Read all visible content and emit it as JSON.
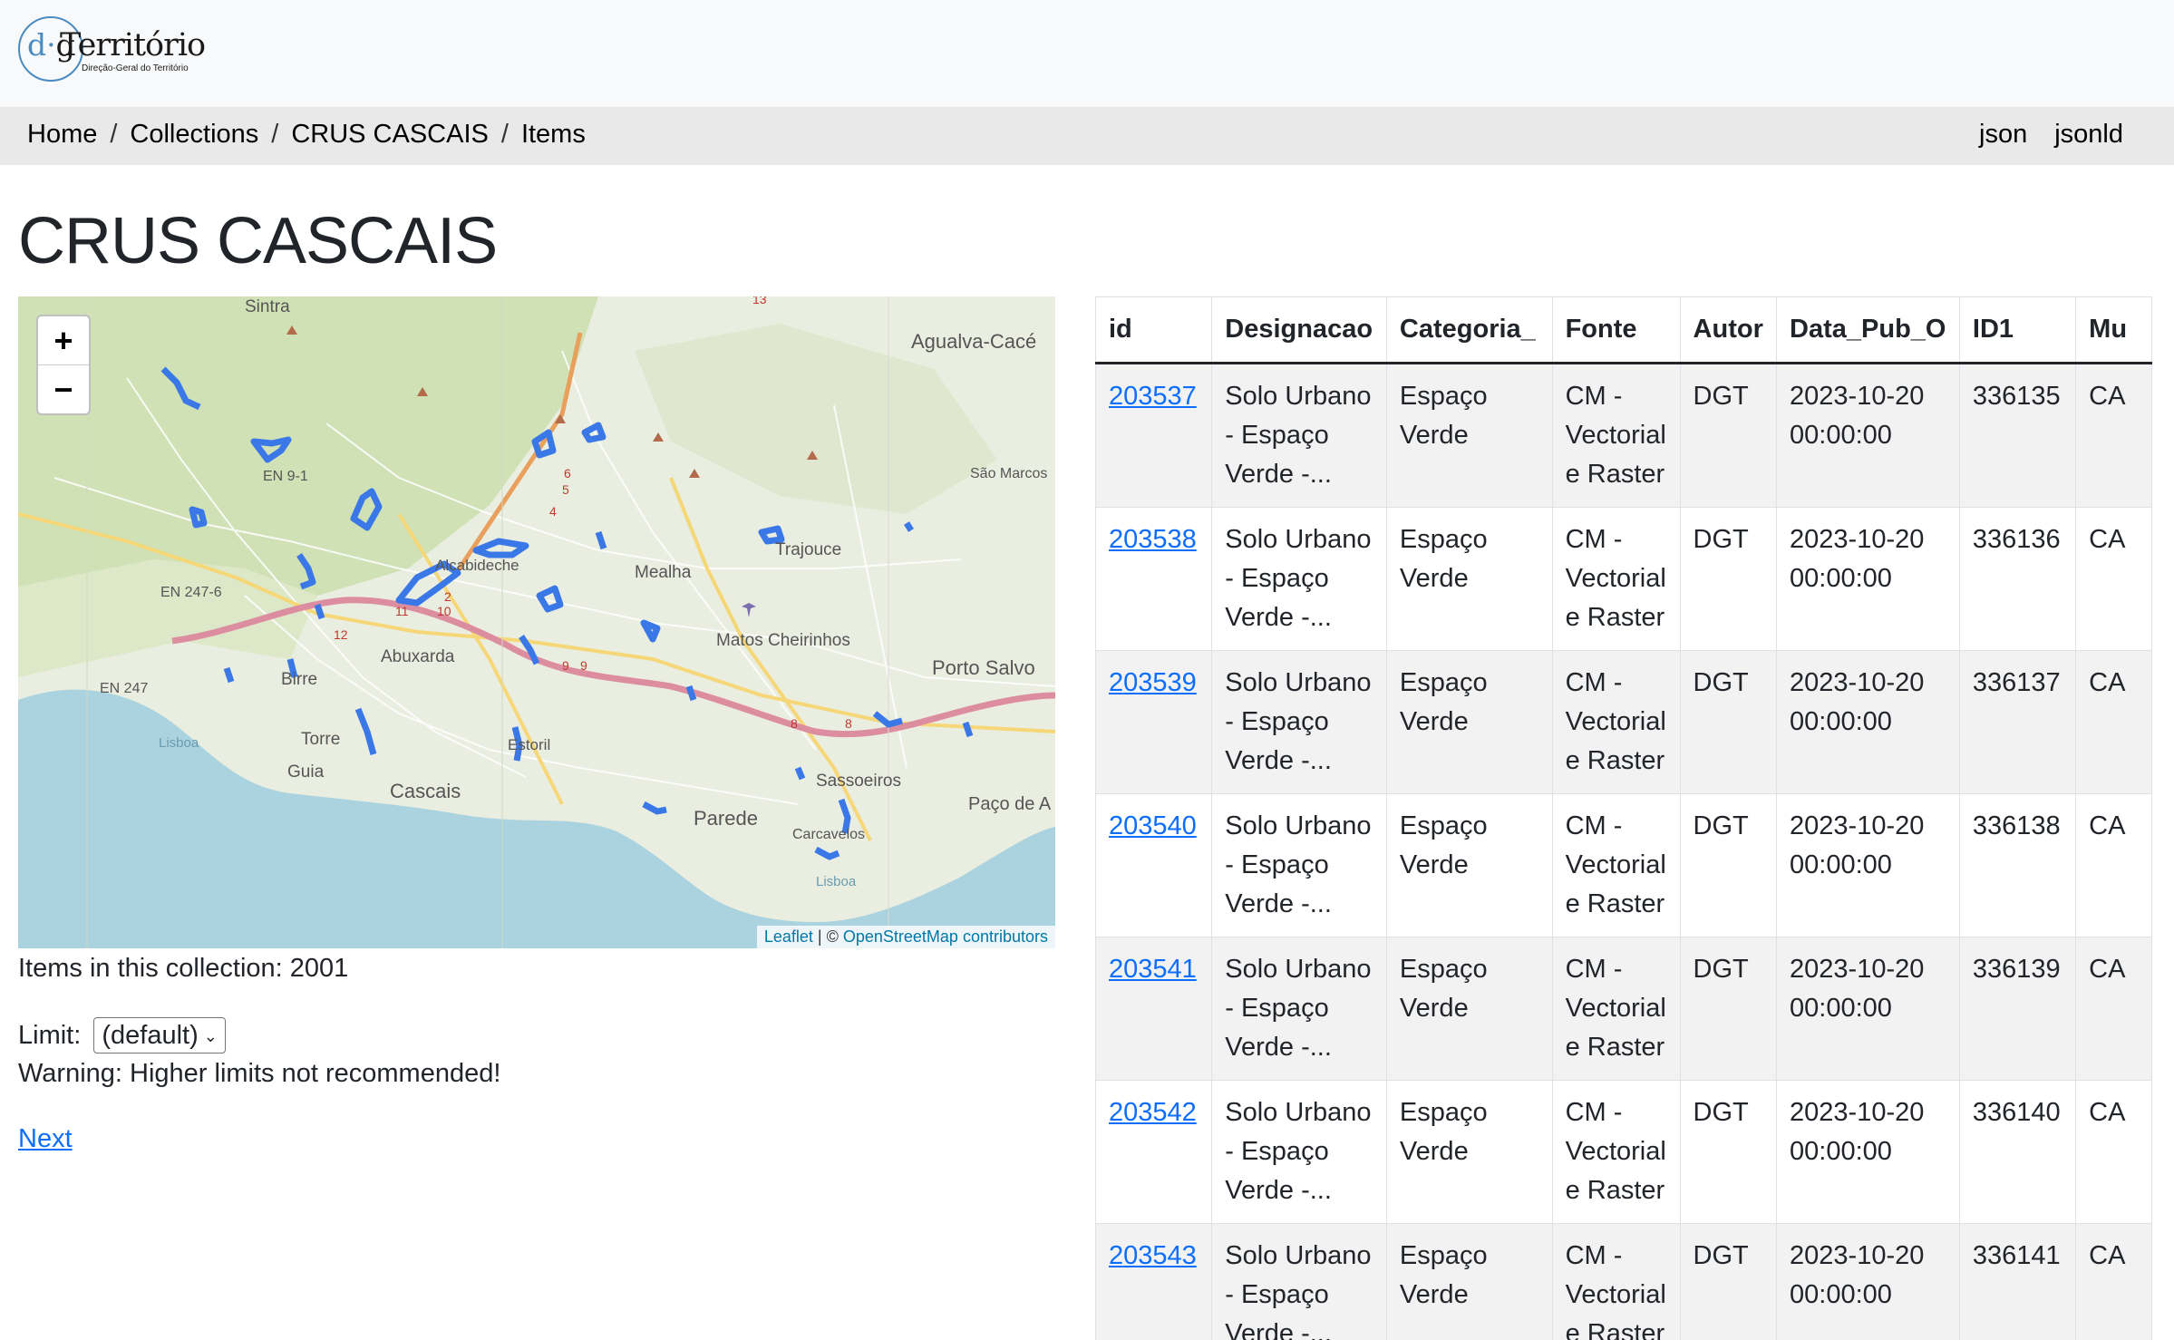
{
  "brand": {
    "logo_prefix_d": "d",
    "logo_prefix_g": "g",
    "logo_name": "Território",
    "logo_sub": "Direção-Geral do Território"
  },
  "breadcrumb": {
    "items": [
      "Home",
      "Collections",
      "CRUS CASCAIS",
      "Items"
    ],
    "separator": "/"
  },
  "formats": [
    "json",
    "jsonld"
  ],
  "page_title": "CRUS CASCAIS",
  "map": {
    "zoom_in": "+",
    "zoom_out": "−",
    "attribution_leaflet": "Leaflet",
    "attribution_sep": " | © ",
    "attribution_osm": "OpenStreetMap contributors",
    "place_labels": [
      "Sintra",
      "Agualva-Cacé",
      "São Marcos",
      "EN 9-1",
      "EN 247-6",
      "EN 247",
      "Alcabideche",
      "Mealha",
      "Trajouce",
      "Matos Cheirinhos",
      "Porto Salvo",
      "Abuxarda",
      "Birre",
      "Torre",
      "Guia",
      "Cascais",
      "Estoril",
      "Parede",
      "Sassoeiros",
      "Carcavelos",
      "Paço de A",
      "Lisboa",
      "Lisboa"
    ],
    "road_numbers": [
      "13",
      "6",
      "5",
      "4",
      "2",
      "11",
      "10",
      "12",
      "9",
      "9",
      "8",
      "8"
    ]
  },
  "items_count_text": "Items in this collection: 2001",
  "limit": {
    "label": "Limit:",
    "selected": "(default)"
  },
  "warning_text": "Warning: Higher limits not recommended!",
  "next_link": "Next",
  "table": {
    "headers": [
      "id",
      "Designacao",
      "Categoria_",
      "Fonte",
      "Autor",
      "Data_Pub_O",
      "ID1",
      "Mu"
    ],
    "rows": [
      {
        "id": "203537",
        "des1": "Solo Urbano",
        "des2": "- Espaço",
        "des3": "Verde -...",
        "cat1": "Espaço",
        "cat2": "Verde",
        "fon1": "CM -",
        "fon2": "Vectorial",
        "fon3": "e Raster",
        "autor": "DGT",
        "dat1": "2023-10-20",
        "dat2": "00:00:00",
        "id1": "336135",
        "mu": "CA"
      },
      {
        "id": "203538",
        "des1": "Solo Urbano",
        "des2": "- Espaço",
        "des3": "Verde -...",
        "cat1": "Espaço",
        "cat2": "Verde",
        "fon1": "CM -",
        "fon2": "Vectorial",
        "fon3": "e Raster",
        "autor": "DGT",
        "dat1": "2023-10-20",
        "dat2": "00:00:00",
        "id1": "336136",
        "mu": "CA"
      },
      {
        "id": "203539",
        "des1": "Solo Urbano",
        "des2": "- Espaço",
        "des3": "Verde -...",
        "cat1": "Espaço",
        "cat2": "Verde",
        "fon1": "CM -",
        "fon2": "Vectorial",
        "fon3": "e Raster",
        "autor": "DGT",
        "dat1": "2023-10-20",
        "dat2": "00:00:00",
        "id1": "336137",
        "mu": "CA"
      },
      {
        "id": "203540",
        "des1": "Solo Urbano",
        "des2": "- Espaço",
        "des3": "Verde -...",
        "cat1": "Espaço",
        "cat2": "Verde",
        "fon1": "CM -",
        "fon2": "Vectorial",
        "fon3": "e Raster",
        "autor": "DGT",
        "dat1": "2023-10-20",
        "dat2": "00:00:00",
        "id1": "336138",
        "mu": "CA"
      },
      {
        "id": "203541",
        "des1": "Solo Urbano",
        "des2": "- Espaço",
        "des3": "Verde -...",
        "cat1": "Espaço",
        "cat2": "Verde",
        "fon1": "CM -",
        "fon2": "Vectorial",
        "fon3": "e Raster",
        "autor": "DGT",
        "dat1": "2023-10-20",
        "dat2": "00:00:00",
        "id1": "336139",
        "mu": "CA"
      },
      {
        "id": "203542",
        "des1": "Solo Urbano",
        "des2": "- Espaço",
        "des3": "Verde -...",
        "cat1": "Espaço",
        "cat2": "Verde",
        "fon1": "CM -",
        "fon2": "Vectorial",
        "fon3": "e Raster",
        "autor": "DGT",
        "dat1": "2023-10-20",
        "dat2": "00:00:00",
        "id1": "336140",
        "mu": "CA"
      },
      {
        "id": "203543",
        "des1": "Solo Urbano",
        "des2": "- Espaço",
        "des3": "Verde -...",
        "cat1": "Espaço",
        "cat2": "Verde",
        "fon1": "CM -",
        "fon2": "Vectorial",
        "fon3": "e Raster",
        "autor": "DGT",
        "dat1": "2023-10-20",
        "dat2": "00:00:00",
        "id1": "336141",
        "mu": "CA"
      }
    ]
  },
  "colors": {
    "link": "#0d6efd",
    "feature_blue": "#3a78e8",
    "sea": "#aad3df",
    "navbar_bg": "#f8f9fa",
    "breadcrumb_bg": "#e9e9e9"
  }
}
